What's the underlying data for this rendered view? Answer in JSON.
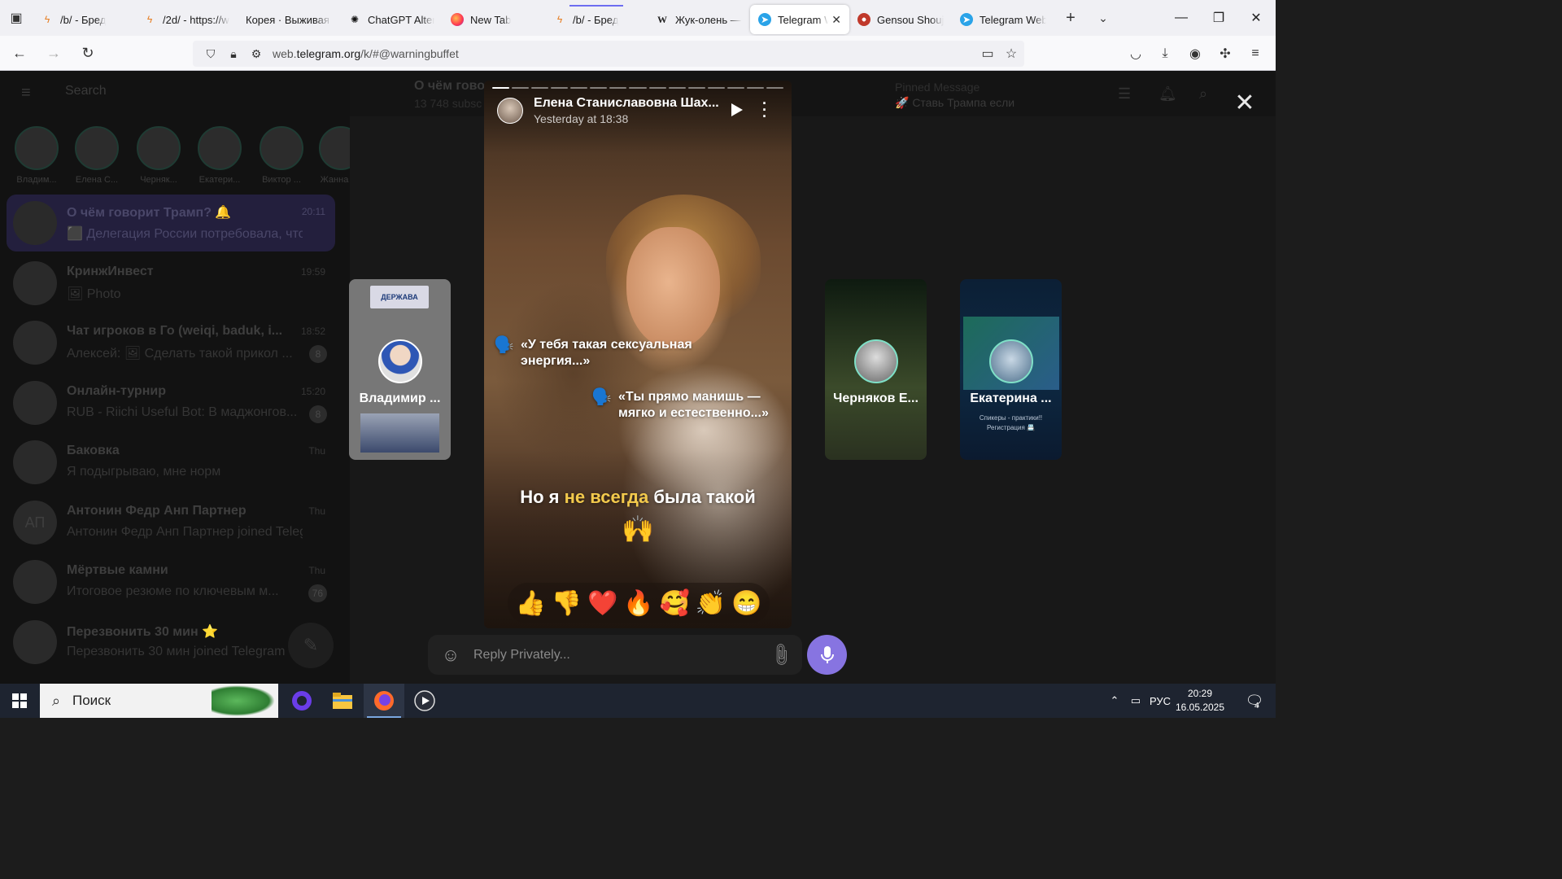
{
  "browser": {
    "tabs": [
      {
        "title": "/b/ - Бред",
        "icon": "bolt-icon"
      },
      {
        "title": "/2d/ - https://w",
        "icon": "bolt-icon"
      },
      {
        "title": "Корея · Выживая в",
        "icon": "none"
      },
      {
        "title": "ChatGPT Altern",
        "icon": "chatgpt-icon"
      },
      {
        "title": "New Tab",
        "icon": "firefox-icon"
      },
      {
        "title": "/b/ - Бред",
        "icon": "bolt-icon"
      },
      {
        "title": "Жук-олень — В",
        "icon": "wikipedia-icon"
      },
      {
        "title": "Telegram We",
        "icon": "telegram-icon",
        "active": true
      },
      {
        "title": "Gensou Shoujo",
        "icon": "gensou-icon"
      },
      {
        "title": "Telegram Web",
        "icon": "telegram-icon"
      }
    ],
    "url_prefix": "web.",
    "url_domain": "telegram.org",
    "url_suffix": "/k/#@warningbuffet"
  },
  "telegram": {
    "sidebar": {
      "search_placeholder": "Search",
      "stories": [
        "Владим...",
        "Елена С...",
        "Черняк...",
        "Екатери...",
        "Виктор ...",
        "Жанна"
      ],
      "chats": [
        {
          "title": "О чём говорит Трамп? 🔔",
          "message": "⬛ Делегация России потребовала, что...",
          "time": "20:11",
          "active": true
        },
        {
          "title": "КринжИнвест",
          "message": "🖼 Photo",
          "time": "19:59"
        },
        {
          "title": "Чат игроков в Го (weiqi, baduk, i...",
          "message": "Алексей: 🖼 Сделать такой прикол ...",
          "time": "18:52",
          "badge": "8"
        },
        {
          "title": "Онлайн-турнир",
          "message": "RUB - Riichi Useful Bot: В маджонгов...",
          "time": "15:20",
          "badge": "8"
        },
        {
          "title": "Баковка",
          "message": "Я подыгрываю, мне норм",
          "time": "Thu"
        },
        {
          "title": "Антонин Федр Анп Партнер",
          "message": "Антонин Федр Анп Партнер joined Teleg...",
          "time": "Thu",
          "initials": "АП"
        },
        {
          "title": "Мёртвые камни",
          "message": "Итоговое резюме по ключевым м...",
          "time": "Thu",
          "badge": "76"
        },
        {
          "title": "Перезвонить 30 мин ⭐",
          "message": "Перезвонить 30 мин joined Telegram",
          "time": ""
        }
      ]
    },
    "header": {
      "chat_title": "О чём гово",
      "chat_subtitle": "13 748 subsc",
      "pinned_label": "Pinned Message",
      "pinned_text": "🚀 Ставь Трампа если"
    }
  },
  "story_viewer": {
    "author": "Елена Станиславовна Шах...",
    "time": "Yesterday at 18:38",
    "progress": {
      "segments": 15,
      "current": 1
    },
    "quote1": "«У тебя такая сексуальная энергия...»",
    "quote2": "«Ты прямо манишь — мягко и естественно...»",
    "caption_pre": "Но я ",
    "caption_highlight": "не всегда",
    "caption_post": " была такой",
    "caption_emoji": "🙌",
    "reactions": [
      "👍",
      "👎",
      "❤️",
      "🔥",
      "🥰",
      "👏",
      "😁"
    ],
    "prev_story": {
      "name": "Владимир ...",
      "logo": "ДЕРЖАВА"
    },
    "next_stories": [
      {
        "name": "Черняков Е..."
      },
      {
        "name": "Екатерина ...",
        "subtitle": "Спикеры - практики!! Регистрация 📇"
      }
    ],
    "reply_placeholder": "Reply Privately..."
  },
  "taskbar": {
    "search_placeholder": "Поиск",
    "language": "РУС",
    "time": "20:29",
    "date": "16.05.2025",
    "notification_count": "4"
  },
  "colors": {
    "accent_purple": "#8774e1",
    "caption_highlight": "#f2c94c",
    "telegram_blue": "#2aa3e8"
  }
}
